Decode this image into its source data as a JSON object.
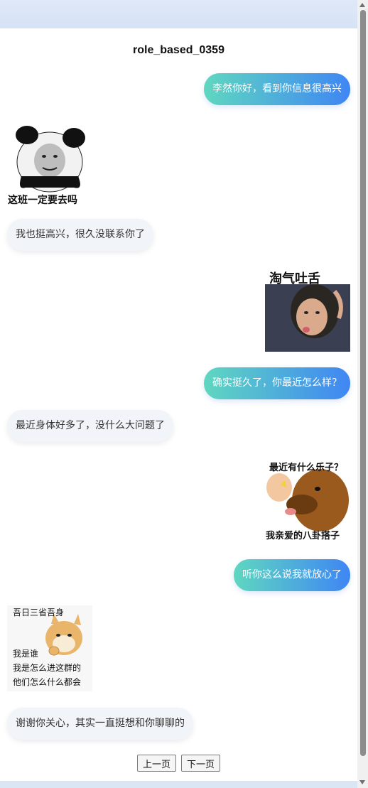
{
  "conversation": {
    "title": "role_based_0359",
    "messages": [
      {
        "side": "me",
        "type": "text",
        "text": "李然你好，看到你信息很高兴"
      },
      {
        "side": "them",
        "type": "sticker",
        "caption": "这班一定要去吗",
        "icon": "panda-meme-sticker"
      },
      {
        "side": "them",
        "type": "text",
        "text": "我也挺高兴，很久没联系你了"
      },
      {
        "side": "me",
        "type": "sticker",
        "caption": "淘气吐舌",
        "icon": "tongue-out-girl-sticker"
      },
      {
        "side": "me",
        "type": "text",
        "text": "确实挺久了，你最近怎么样？"
      },
      {
        "side": "them",
        "type": "text",
        "text": "最近身体好多了，没什么大问题了"
      },
      {
        "side": "me",
        "type": "sticker",
        "caption_top": "最近有什么乐子？",
        "caption_bottom": "我亲爱的八卦搭子",
        "icon": "gossip-dog-sticker"
      },
      {
        "side": "me",
        "type": "text",
        "text": "听你这么说我就放心了"
      },
      {
        "side": "them",
        "type": "sticker",
        "lines": [
          "吾日三省吾身",
          "我是谁",
          "我是怎么进这群的",
          "他们怎么什么都会"
        ],
        "icon": "thinking-doge-sticker"
      },
      {
        "side": "them",
        "type": "text",
        "text": "谢谢你关心，其实一直挺想和你聊聊的"
      }
    ]
  },
  "pagination": {
    "prev_label": "上一页",
    "next_label": "下一页"
  },
  "colors": {
    "me_bubble_start": "#5fd7c0",
    "me_bubble_end": "#3f86f4",
    "them_bubble": "#f1f4f9",
    "header_band": "#d6e2f6"
  }
}
